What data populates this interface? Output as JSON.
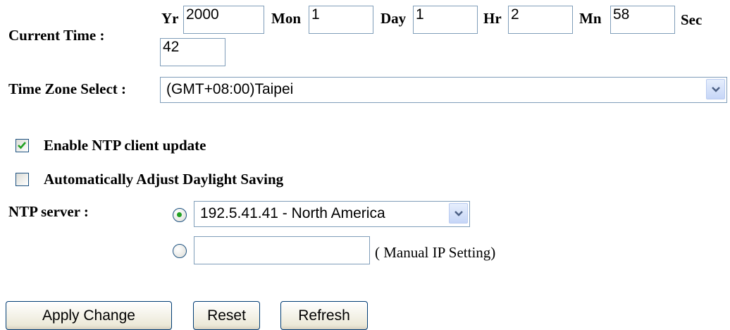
{
  "current_time": {
    "label": "Current Time :",
    "yr_label": "Yr",
    "yr": "2000",
    "mon_label": "Mon",
    "mon": "1",
    "day_label": "Day",
    "day": "1",
    "hr_label": "Hr",
    "hr": "2",
    "mn_label": "Mn",
    "mn": "58",
    "sec_label": "Sec",
    "sec": "42"
  },
  "timezone": {
    "label": "Time Zone Select :",
    "selected": "(GMT+08:00)Taipei"
  },
  "ntp_enable": {
    "label": "Enable NTP client update",
    "checked": true
  },
  "daylight_saving": {
    "label": "Automatically Adjust Daylight Saving",
    "checked": false
  },
  "ntp_server": {
    "label": "NTP server :",
    "preset_selected": true,
    "preset_value": "192.5.41.41 - North America",
    "manual_value": "",
    "manual_hint": "( Manual IP Setting)"
  },
  "buttons": {
    "apply": "Apply Change",
    "reset": "Reset",
    "refresh": "Refresh"
  },
  "icons": {
    "dropdown": "chevron-down-icon",
    "check": "check-icon"
  },
  "colors": {
    "input_border": "#7f9db9",
    "check_mark": "#21a121",
    "control_border": "#1c5180",
    "button_border": "#003c74"
  }
}
